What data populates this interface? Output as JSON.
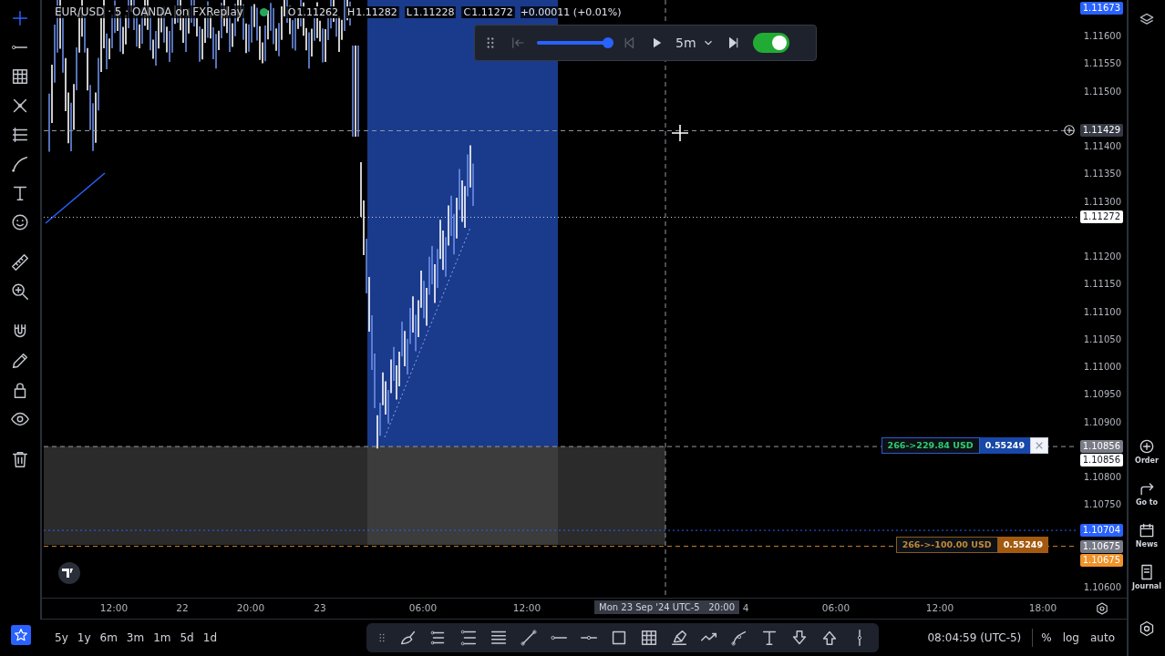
{
  "legend": {
    "symbol": "EUR/USD · 5 · OANDA on FXReplay",
    "market_open": true,
    "ohlc": [
      {
        "label": "O",
        "value": "1.11262"
      },
      {
        "label": "H",
        "value": "1.11282"
      },
      {
        "label": "L",
        "value": "1.11228"
      },
      {
        "label": "C",
        "value": "1.11272"
      }
    ],
    "change": "+0.00011 (+0.01%)"
  },
  "replay": {
    "level": 0.97,
    "timeframe": "5m",
    "on": true
  },
  "left_toolbar": [
    {
      "selected": true
    },
    {
      "selected": false
    },
    {
      "selected": false
    },
    {
      "selected": false
    },
    {
      "selected": false
    },
    {
      "selected": false
    },
    {
      "selected": false
    },
    {
      "selected": false
    },
    {
      "selected": false
    },
    {
      "selected": false
    },
    {
      "selected": false
    },
    {
      "selected": false
    },
    {
      "selected": false
    },
    {
      "selected": false
    },
    {
      "selected": false
    }
  ],
  "price_axis": {
    "labels": [
      "1.11600",
      "1.11550",
      "1.11500",
      "1.11400",
      "1.11350",
      "1.11300",
      "1.11200",
      "1.11150",
      "1.11100",
      "1.11050",
      "1.11000",
      "1.10950",
      "1.10900",
      "1.10800",
      "1.10750",
      "1.10600"
    ],
    "tags": [
      {
        "text": "1.11673",
        "kind": "high",
        "color": "#2962ff"
      },
      {
        "text": "1.11429",
        "kind": "crosshair",
        "color": "#363a45"
      },
      {
        "text": "1.11272",
        "kind": "last",
        "color": "#ffffff"
      },
      {
        "text": "1.10856",
        "kind": "entry",
        "color": "#787b86"
      },
      {
        "text": "1.10856",
        "kind": "entry-label",
        "color": "#ffffff"
      },
      {
        "text": "1.10704",
        "kind": "alert",
        "color": "#2962ff"
      },
      {
        "text": "1.10675",
        "kind": "stop",
        "color": "#787b86"
      },
      {
        "text": "1.10675",
        "kind": "stop-label",
        "color": "#f0932b"
      }
    ]
  },
  "positions": [
    {
      "kind": "target",
      "label": "266->229.84 USD",
      "price": "0.55249",
      "closable": true
    },
    {
      "kind": "stop",
      "label": "266->-100.00 USD",
      "price": "0.55249",
      "closable": false
    }
  ],
  "time_axis": {
    "labels": [
      "12:00",
      "22",
      "20:00",
      "23",
      "06:00",
      "12:00",
      "4",
      "06:00",
      "12:00",
      "18:00"
    ],
    "crosshair": "Mon 23 Sep '24 UTC-5   20:00"
  },
  "ranges": [
    "5y",
    "1y",
    "6m",
    "3m",
    "1m",
    "5d",
    "1d"
  ],
  "status": {
    "time": "08:04:59 (UTC-5)",
    "percent": "%",
    "log": "log",
    "auto": "auto"
  },
  "right_sidebar": [
    {
      "label": "Order"
    },
    {
      "label": "Go to"
    },
    {
      "label": "News"
    },
    {
      "label": "Journal"
    }
  ]
}
